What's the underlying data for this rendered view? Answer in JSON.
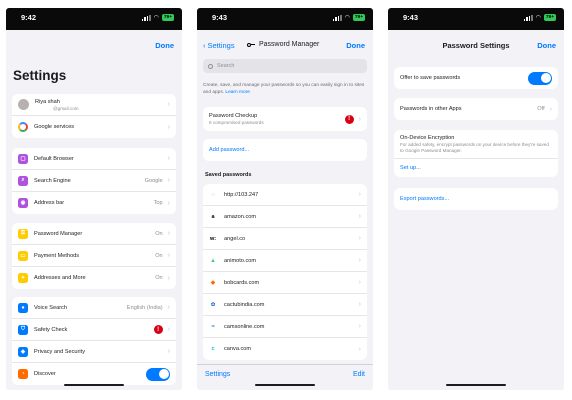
{
  "screens": [
    {
      "time": "9:42",
      "battery": "79+",
      "done": "Done",
      "title": "Settings",
      "account": {
        "name": "Riya shah",
        "email": "@gmail.com"
      },
      "google_services": "Google services",
      "group2": [
        {
          "label": "Default Browser",
          "value": "",
          "icon_color": "#af52de",
          "icon": "default-browser-icon"
        },
        {
          "label": "Search Engine",
          "value": "Google",
          "icon_color": "#af52de",
          "icon": "search-icon"
        },
        {
          "label": "Address bar",
          "value": "Top",
          "icon_color": "#af52de",
          "icon": "address-bar-icon"
        }
      ],
      "group3": [
        {
          "label": "Password Manager",
          "value": "On",
          "icon_color": "#ffcc00",
          "icon": "key-icon"
        },
        {
          "label": "Payment Methods",
          "value": "On",
          "icon_color": "#ffcc00",
          "icon": "card-icon"
        },
        {
          "label": "Addresses and More",
          "value": "On",
          "icon_color": "#ffcc00",
          "icon": "location-icon"
        }
      ],
      "group4": [
        {
          "label": "Voice Search",
          "value": "English (India)",
          "icon_color": "#007aff",
          "icon": "mic-icon"
        },
        {
          "label": "Safety Check",
          "value": "",
          "icon_color": "#007aff",
          "icon": "shield-icon"
        },
        {
          "label": "Privacy and Security",
          "value": "",
          "icon_color": "#007aff",
          "icon": "privacy-icon"
        },
        {
          "label": "Discover",
          "value": "",
          "icon_color": "#ff6a00",
          "icon": "discover-icon"
        }
      ]
    },
    {
      "time": "9:43",
      "battery": "79+",
      "back": "Settings",
      "title": "Password Manager",
      "done": "Done",
      "search_placeholder": "Search",
      "description": "Create, save, and manage your passwords so you can easily sign in to sites and apps.",
      "learn_more": "Learn more",
      "checkup": {
        "title": "Password Checkup",
        "subtitle": "6 compromised passwords"
      },
      "add_password": "Add password...",
      "saved_header": "Saved passwords",
      "saved": [
        {
          "site": "http://103.247",
          "glyph": "◌",
          "color": "#8e8e93"
        },
        {
          "site": "amazon.com",
          "glyph": "a",
          "color": "#000000"
        },
        {
          "site": "angel.co",
          "glyph": "w:",
          "color": "#000000"
        },
        {
          "site": "animoto.com",
          "glyph": "▲",
          "color": "#2ecc71"
        },
        {
          "site": "bobcards.com",
          "glyph": "◆",
          "color": "#ff6600"
        },
        {
          "site": "cactubindia.com",
          "glyph": "✿",
          "color": "#2d7be0"
        },
        {
          "site": "camsonline.com",
          "glyph": "≈",
          "color": "#1e88e5"
        },
        {
          "site": "canva.com",
          "glyph": "c",
          "color": "#00c4cc"
        }
      ],
      "toolbar_left": "Settings",
      "toolbar_right": "Edit"
    },
    {
      "time": "9:43",
      "battery": "79+",
      "title": "Password Settings",
      "done": "Done",
      "offer": "Offer to save passwords",
      "other_apps": {
        "label": "Passwords in other Apps",
        "value": "Off"
      },
      "encryption": {
        "title": "On-Device Encryption",
        "body": "For added safety, encrypt passwords on your device before they're saved to Google Password Manager.",
        "setup": "Set up..."
      },
      "export": "Export passwords..."
    }
  ]
}
